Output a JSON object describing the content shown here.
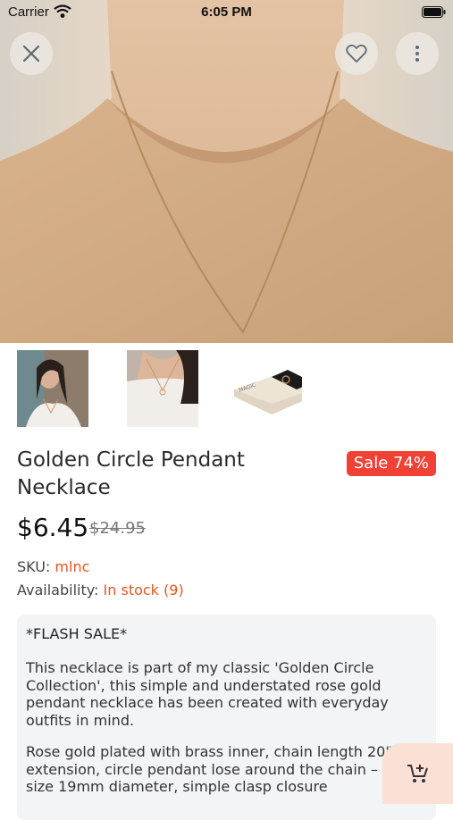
{
  "status_bar": {
    "carrier": "Carrier",
    "time": "6:05 PM"
  },
  "gallery": {
    "main_image": "model-wearing-necklace-photo",
    "thumbnails": [
      "woman-wearing-necklace-thumbnail",
      "necklace-closeup-thumbnail",
      "necklace-gift-box-thumbnail"
    ],
    "box_brand": "MAGIC"
  },
  "product": {
    "title": "Golden Circle Pendant Necklace",
    "sale_badge": "Sale 74%",
    "price": "$6.45",
    "old_price": "$24.95",
    "sku_label": "SKU:",
    "sku": "mlnc",
    "availability_label": "Availability:",
    "availability": "In stock",
    "stock_count": "(9)"
  },
  "description": {
    "flash": "*FLASH SALE*",
    "p1": "This necklace is part of my classic 'Golden Circle Collection', this simple and understated rose gold pendant necklace has been created with everyday outfits in mind.",
    "p2": "Rose gold plated with brass inner, chain length 20\" + extension, circle pendant lose around the chain – circle size 19mm diameter, simple clasp closure"
  },
  "colors": {
    "accent": "#e5561f",
    "sale": "#ef4136",
    "fab": "#fbe0d6"
  }
}
